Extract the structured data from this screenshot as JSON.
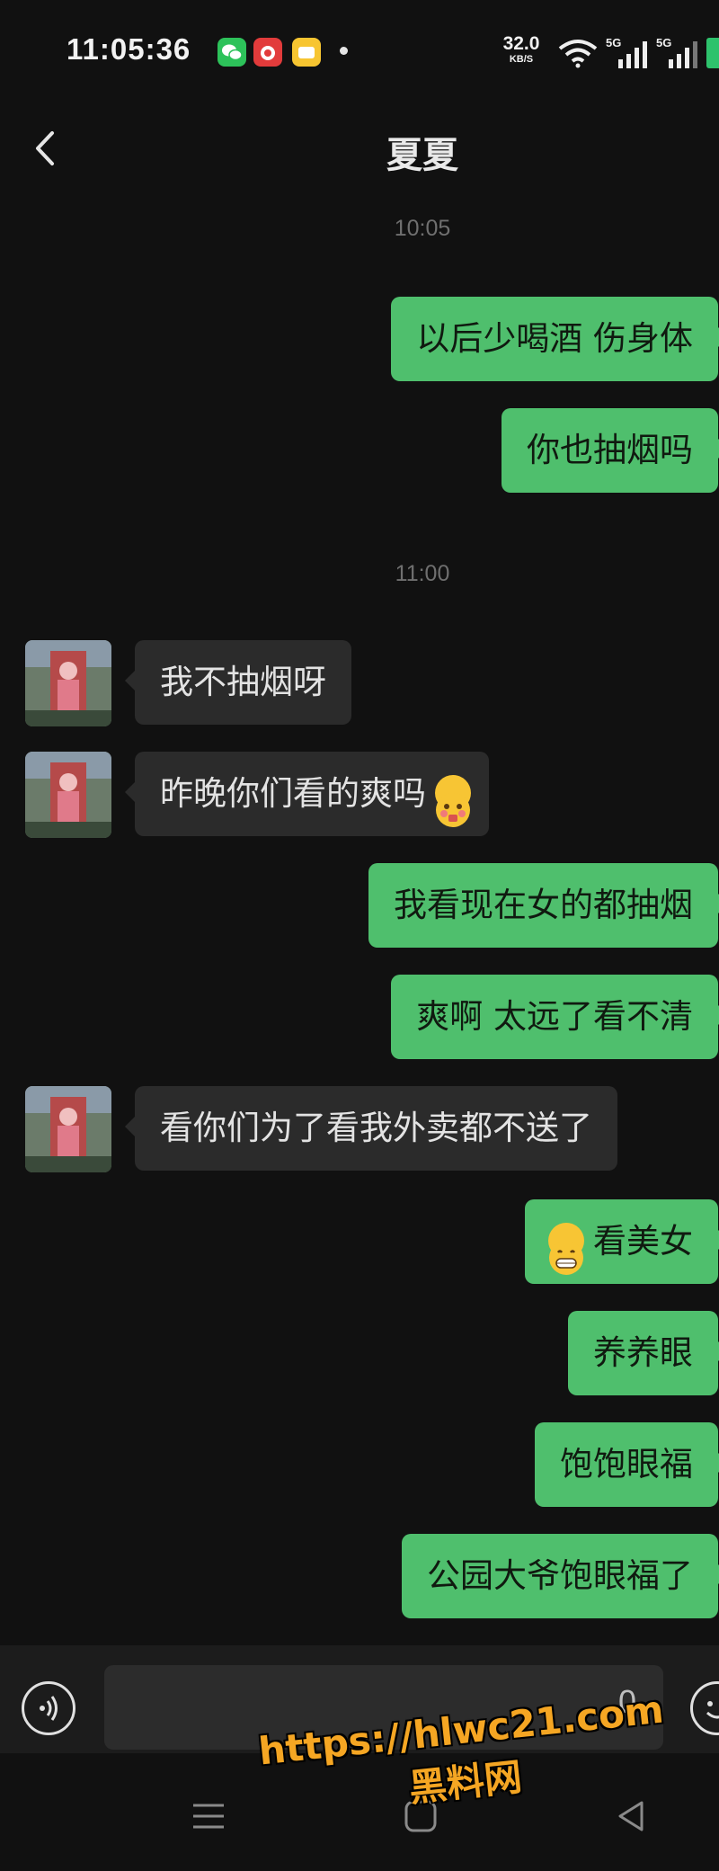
{
  "status_bar": {
    "time": "11:05:36",
    "net_speed_value": "32.0",
    "net_speed_unit": "KB/S",
    "signal_1_label": "5G",
    "signal_2_label": "5G"
  },
  "header": {
    "title": "夏夏"
  },
  "chat": {
    "timestamps": [
      "10:05",
      "11:00"
    ],
    "messages": [
      {
        "side": "out",
        "text": "以后少喝酒  伤身体"
      },
      {
        "side": "out",
        "text": "你也抽烟吗"
      },
      {
        "side": "in",
        "text": "我不抽烟呀"
      },
      {
        "side": "in",
        "text": "昨晚你们看的爽吗"
      },
      {
        "side": "out",
        "text": "我看现在女的都抽烟"
      },
      {
        "side": "out",
        "text": "爽啊  太远了看不清"
      },
      {
        "side": "in",
        "text": "看你们为了看我外卖都不送了"
      },
      {
        "side": "out",
        "text": "看美女"
      },
      {
        "side": "out",
        "text": "养养眼"
      },
      {
        "side": "out",
        "text": "饱饱眼福"
      },
      {
        "side": "out",
        "text": "公园大爷饱眼福了"
      }
    ]
  },
  "input_bar": {
    "placeholder": "",
    "side_char": "0"
  },
  "watermark": {
    "url": "https://hlwc21.com",
    "name": "黑料网"
  },
  "colors": {
    "background": "#111111",
    "outgoing_bubble": "#4fbf6d",
    "incoming_bubble": "#2b2b2b",
    "watermark": "#f5a623"
  },
  "icons": [
    "wechat-icon",
    "app-icon-red",
    "app-icon-yellow",
    "wifi-icon",
    "signal-icon",
    "battery-icon",
    "back-chevron-icon",
    "voice-icon",
    "emoji-icon",
    "menu-icon",
    "home-icon",
    "back-nav-icon"
  ]
}
